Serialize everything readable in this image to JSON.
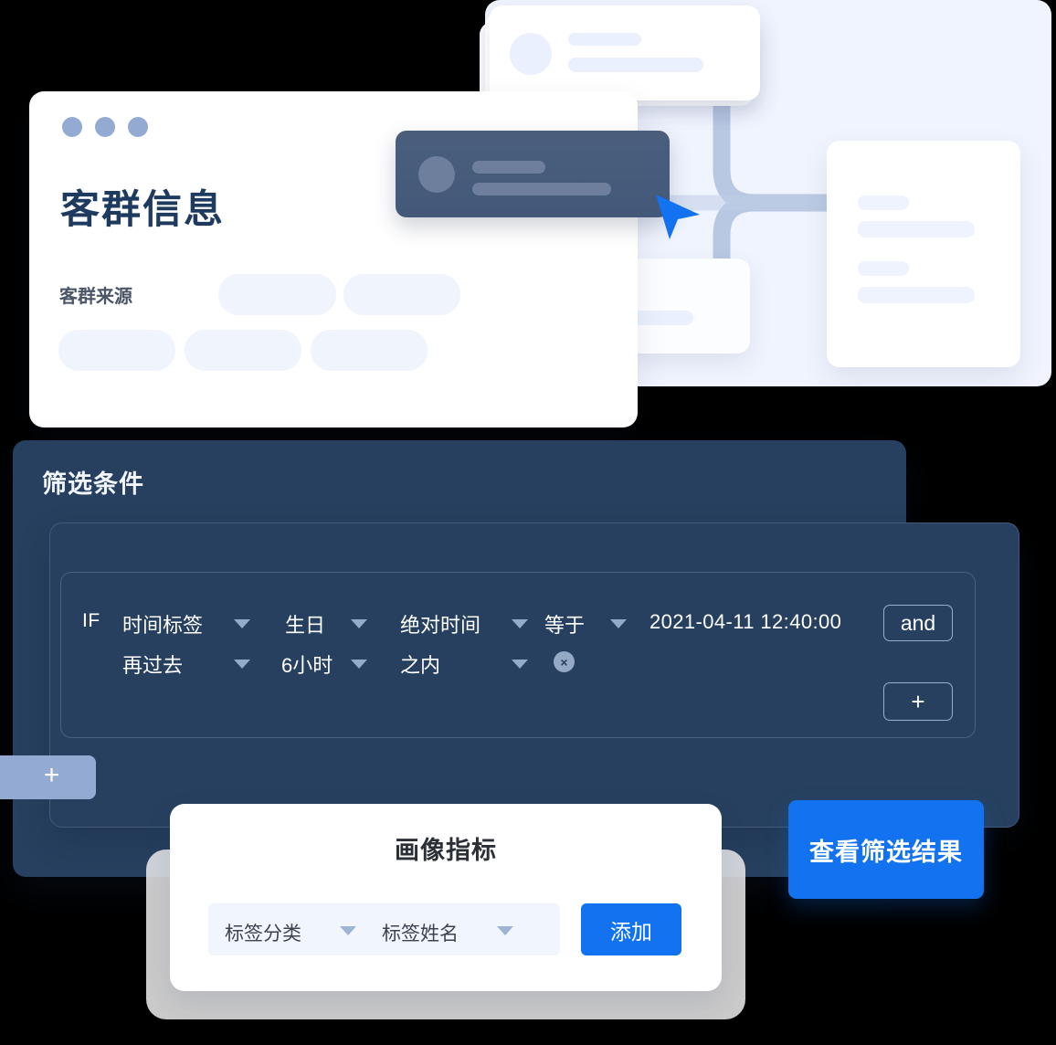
{
  "meta": {
    "accent_blue": "#1272F0",
    "dark_panel": "#27405F",
    "light_backdrop": "#F0F4FE",
    "placeholder_blue": "#EAF0FD",
    "dot_blue": "#93ABD3"
  },
  "main_card": {
    "title": "客群信息",
    "source_label": "客群来源",
    "window_dots": [
      "dot-1",
      "dot-2",
      "dot-3"
    ]
  },
  "filter_panel": {
    "title": "筛选条件",
    "if_label": "IF",
    "row1": [
      {
        "name": "tag-type",
        "value": "时间标签"
      },
      {
        "name": "tag-name",
        "value": "生日"
      },
      {
        "name": "time-mode",
        "value": "绝对时间"
      },
      {
        "name": "operator",
        "value": "等于"
      }
    ],
    "row1_datetime": "2021-04-11 12:40:00",
    "row2": [
      {
        "name": "offset-direction",
        "value": "再过去"
      },
      {
        "name": "offset-amount",
        "value": "6小时"
      },
      {
        "name": "offset-range",
        "value": "之内"
      }
    ],
    "and_label": "and",
    "plus_label": "+",
    "remove_label": "×",
    "side_plus_label": "+"
  },
  "metric_card": {
    "title": "画像指标",
    "selects": [
      {
        "name": "tag-category",
        "value": "标签分类"
      },
      {
        "name": "tag-name",
        "value": "标签姓名"
      }
    ],
    "add_label": "添加"
  },
  "cta": {
    "label": "查看筛选结果"
  }
}
